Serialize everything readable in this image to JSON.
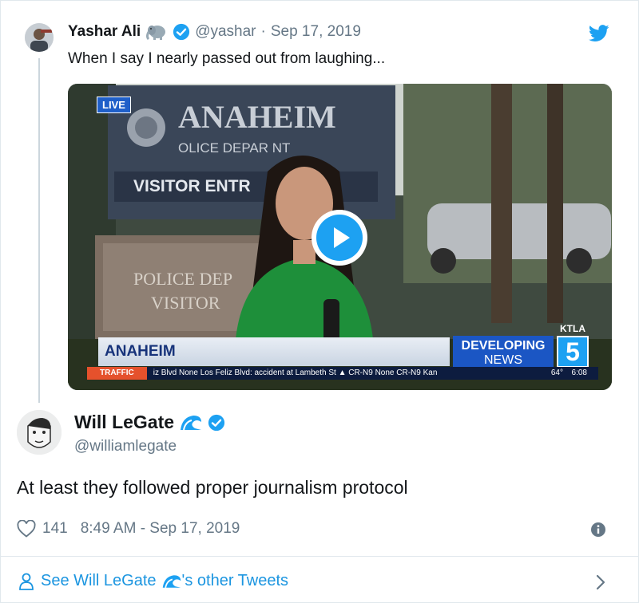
{
  "quoted_tweet": {
    "name": "Yashar Ali",
    "emoji_icon": "elephant-emoji",
    "handle": "@yashar",
    "separator": "·",
    "date": "Sep 17, 2019",
    "text": "When I say I nearly passed out from laughing...",
    "video": {
      "live_badge": "LIVE",
      "building_sign_1": "ANAHEIM",
      "building_sign_2": "OLICE DEPAR      NT",
      "building_sign_3": "VISITOR ENTR",
      "lower_sign_1": "POLICE DEP",
      "lower_sign_2": "VISITOR",
      "lower_third_city": "ANAHEIM",
      "developing_1": "DEVELOPING",
      "developing_2": "NEWS",
      "station": "KTLA",
      "channel": "5",
      "ticker_label": "TRAFFIC",
      "ticker_text": "iz Blvd None Los Feliz Blvd: accident at Lambeth St   ▲  CR-N9 None CR-N9 Kan",
      "ticker_temp": "64°",
      "ticker_time": "6:08"
    }
  },
  "main_tweet": {
    "name": "Will LeGate",
    "emoji_icon": "wave-emoji",
    "handle": "@williamlegate",
    "text": "At least they followed proper journalism protocol",
    "like_count": "141",
    "time": "8:49 AM - Sep 17, 2019"
  },
  "footer": {
    "see_more_label": "See Will LeGate",
    "see_more_suffix": "'s other Tweets"
  },
  "colors": {
    "twitter_blue": "#1da1f2",
    "link_blue": "#1b95e0",
    "muted": "#657786"
  }
}
